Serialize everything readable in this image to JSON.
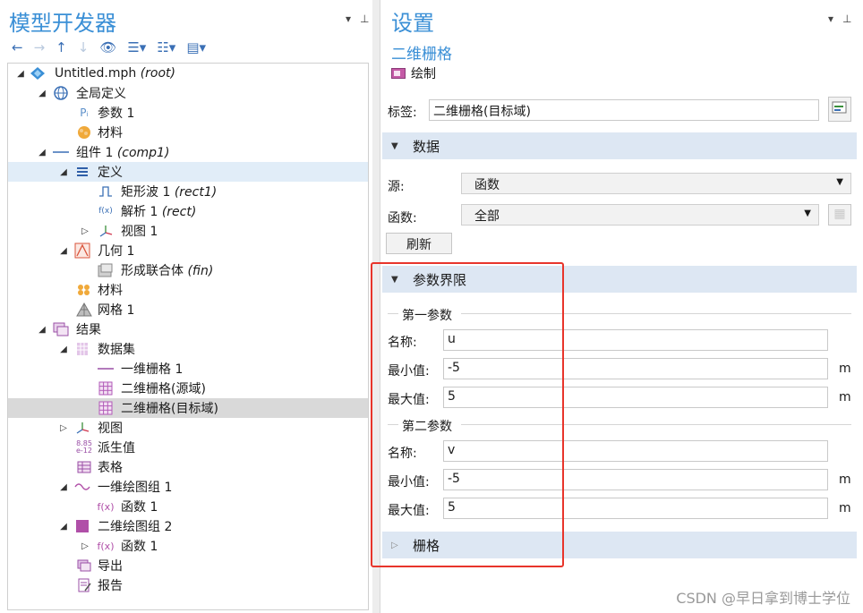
{
  "left_panel": {
    "title": "模型开发器",
    "tree": [
      {
        "label": "Untitled.mph",
        "note": "(root)",
        "icon": "model-icon"
      },
      {
        "label": "全局定义",
        "note": "",
        "icon": "globe-icon"
      },
      {
        "label": "参数 1",
        "note": "",
        "icon": "parameters-icon"
      },
      {
        "label": "材料",
        "note": "",
        "icon": "materials-icon"
      },
      {
        "label": "组件 1",
        "note": "(comp1)",
        "icon": "component-icon"
      },
      {
        "label": "定义",
        "note": "",
        "icon": "definitions-icon"
      },
      {
        "label": "矩形波 1",
        "note": "(rect1)",
        "icon": "rectangle-wave-icon"
      },
      {
        "label": "解析 1",
        "note": "(rect)",
        "icon": "analytic-function-icon"
      },
      {
        "label": "视图 1",
        "note": "",
        "icon": "view-icon"
      },
      {
        "label": "几何 1",
        "note": "",
        "icon": "geometry-icon"
      },
      {
        "label": "形成联合体",
        "note": "(fin)",
        "icon": "form-union-icon"
      },
      {
        "label": "材料",
        "note": "",
        "icon": "materials-icon"
      },
      {
        "label": "网格 1",
        "note": "",
        "icon": "mesh-icon"
      },
      {
        "label": "结果",
        "note": "",
        "icon": "results-icon"
      },
      {
        "label": "数据集",
        "note": "",
        "icon": "datasets-icon"
      },
      {
        "label": "一维栅格 1",
        "note": "",
        "icon": "grid-1d-icon"
      },
      {
        "label": "二维栅格(源域)",
        "note": "",
        "icon": "grid-2d-icon"
      },
      {
        "label": "二维栅格(目标域)",
        "note": "",
        "icon": "grid-2d-icon"
      },
      {
        "label": "视图",
        "note": "",
        "icon": "view-icon"
      },
      {
        "label": "派生值",
        "note": "",
        "icon": "derived-values-icon"
      },
      {
        "label": "表格",
        "note": "",
        "icon": "table-icon"
      },
      {
        "label": "一维绘图组 1",
        "note": "",
        "icon": "plot-1d-icon"
      },
      {
        "label": "函数 1",
        "note": "",
        "icon": "function-plot-icon"
      },
      {
        "label": "二维绘图组 2",
        "note": "",
        "icon": "plot-2d-icon"
      },
      {
        "label": "函数 1",
        "note": "",
        "icon": "function-plot-icon"
      },
      {
        "label": "导出",
        "note": "",
        "icon": "export-icon"
      },
      {
        "label": "报告",
        "note": "",
        "icon": "report-icon"
      }
    ]
  },
  "right_panel": {
    "title": "设置",
    "subtitle": "二维栅格",
    "draw_label": "绘制",
    "label_field": {
      "label": "标签:",
      "value": "二维栅格(目标域)"
    },
    "data_section": {
      "title": "数据",
      "source_label": "源:",
      "source_value": "函数",
      "function_label": "函数:",
      "function_value": "全部",
      "refresh_label": "刷新"
    },
    "param_section": {
      "title": "参数界限",
      "first": {
        "title": "第一参数",
        "name_label": "名称:",
        "name_value": "u",
        "min_label": "最小值:",
        "min_value": "-5",
        "max_label": "最大值:",
        "max_value": "5",
        "unit": "m"
      },
      "second": {
        "title": "第二参数",
        "name_label": "名称:",
        "name_value": "v",
        "min_label": "最小值:",
        "min_value": "-5",
        "max_label": "最大值:",
        "max_value": "5",
        "unit": "m"
      }
    },
    "grid_section": {
      "title": "栅格"
    }
  },
  "watermark": "CSDN @早日拿到博士学位",
  "colors": {
    "accent": "#3a8fd6",
    "section_bg": "#dde7f3",
    "highlight": "#e8352b"
  }
}
